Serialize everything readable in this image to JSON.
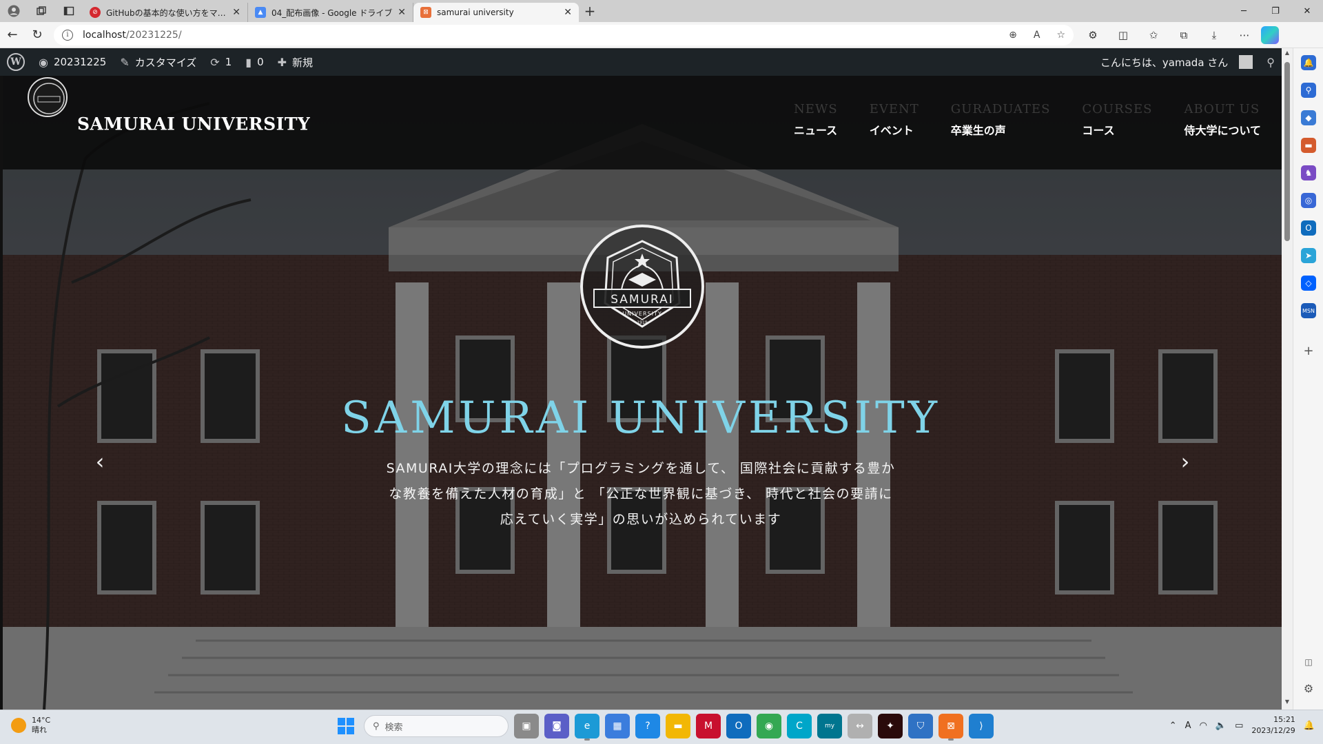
{
  "browser": {
    "tabs": [
      {
        "title": "GitHubの基本的な使い方をマスター",
        "favicon_color": "#d4282f",
        "active": false
      },
      {
        "title": "04_配布画像 - Google ドライブ",
        "favicon_color": "#4a8af4",
        "active": false
      },
      {
        "title": "samurai university",
        "favicon_color": "#e8703a",
        "active": true
      }
    ],
    "url_host": "localhost",
    "url_path": "/20231225/"
  },
  "wp_admin": {
    "site": "20231225",
    "customize": "カスタマイズ",
    "updates": "1",
    "comments": "0",
    "new": "新規",
    "greeting": "こんにちは、yamada さん"
  },
  "site": {
    "name": "SAMURAI UNIVERSITY",
    "nav": [
      {
        "en": "NEWS",
        "ja": "ニュース"
      },
      {
        "en": "EVENT",
        "ja": "イベント"
      },
      {
        "en": "GURADUATES",
        "ja": "卒業生の声"
      },
      {
        "en": "COURSES",
        "ja": "コース"
      },
      {
        "en": "ABOUT US",
        "ja": "侍大学について"
      }
    ],
    "emblem_text": "SAMURAI",
    "emblem_sub": "UNIVERSITY",
    "emblem_year": "1919",
    "hero_title": "SAMURAI UNIVERSITY",
    "hero_line1": "SAMURAI大学の理念には「プログラミングを通して、 国際社会に貢献する豊か",
    "hero_line2": "な教養を備えた人材の育成」と 「公正な世界観に基づき、 時代と社会の要請に",
    "hero_line3": "応えていく実学」の思いが込められています",
    "accent_color": "#7fd3e8"
  },
  "taskbar": {
    "temperature": "14°C",
    "weather": "晴れ",
    "search_placeholder": "検索",
    "time": "15:21",
    "date": "2023/12/29"
  }
}
